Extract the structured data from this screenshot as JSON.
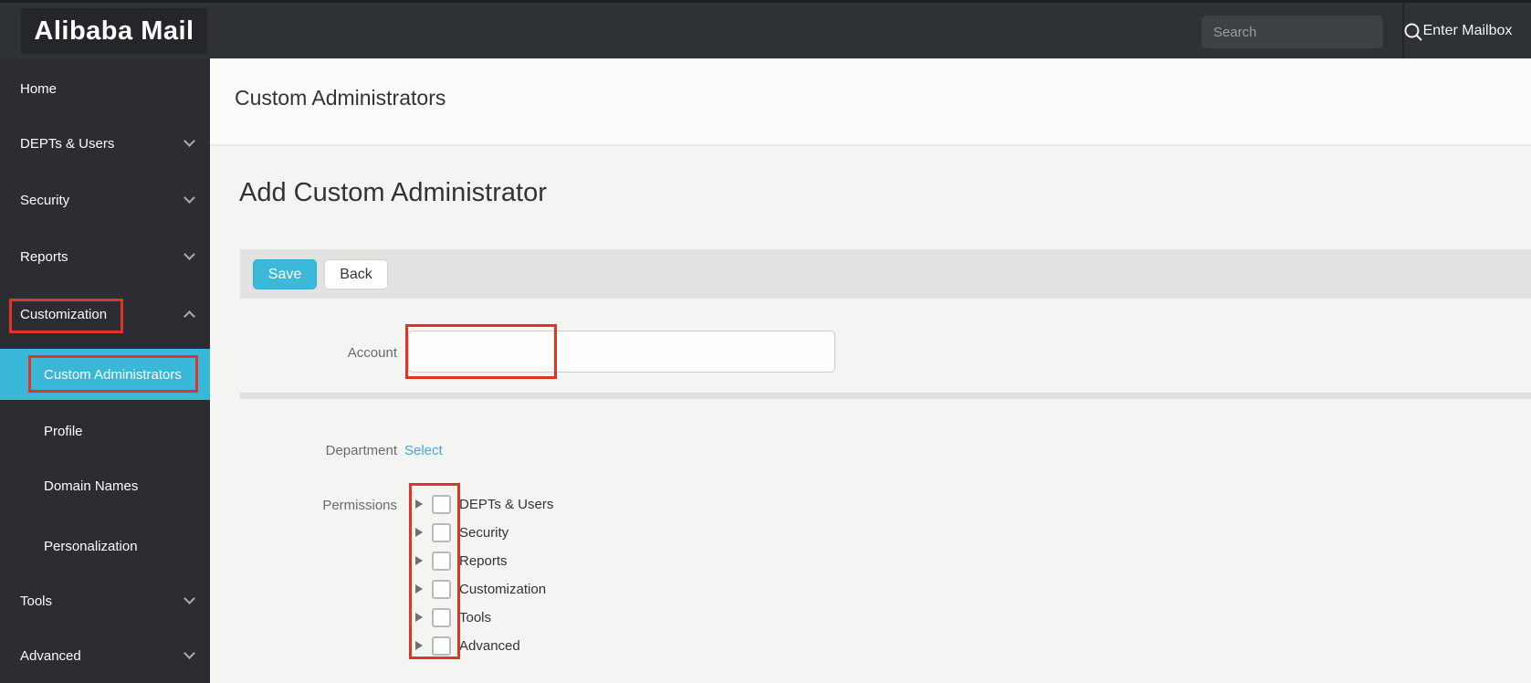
{
  "header": {
    "logo": "Alibaba Mail",
    "search_placeholder": "Search",
    "enter_mailbox_label": "Enter Mailbox"
  },
  "sidebar": {
    "accent_color": "#38b7d8",
    "items": [
      {
        "label": "Home"
      },
      {
        "label": "DEPTs & Users"
      },
      {
        "label": "Security"
      },
      {
        "label": "Reports"
      },
      {
        "label": "Customization"
      },
      {
        "label": "Tools"
      },
      {
        "label": "Advanced"
      }
    ],
    "customization_children": [
      {
        "label": "Custom Administrators"
      },
      {
        "label": "Profile"
      },
      {
        "label": "Domain Names"
      },
      {
        "label": "Personalization"
      }
    ],
    "selected_item": "Custom Administrators"
  },
  "main": {
    "page_title": "Custom Administrators",
    "section_title": "Add Custom Administrator",
    "toolbar": {
      "save_label": "Save",
      "back_label": "Back"
    },
    "form": {
      "account_label": "Account",
      "account_value": "",
      "department_label": "Department",
      "department_select_label": "Select",
      "permissions_label": "Permissions",
      "permission_items": [
        "DEPTs & Users",
        "Security",
        "Reports",
        "Customization",
        "Tools",
        "Advanced"
      ]
    }
  },
  "annotations": {
    "color": "#e23327",
    "boxes": [
      "customization-nav-item",
      "custom-administrators-nav-item",
      "account-input-left",
      "permissions-checkbox-column"
    ]
  }
}
